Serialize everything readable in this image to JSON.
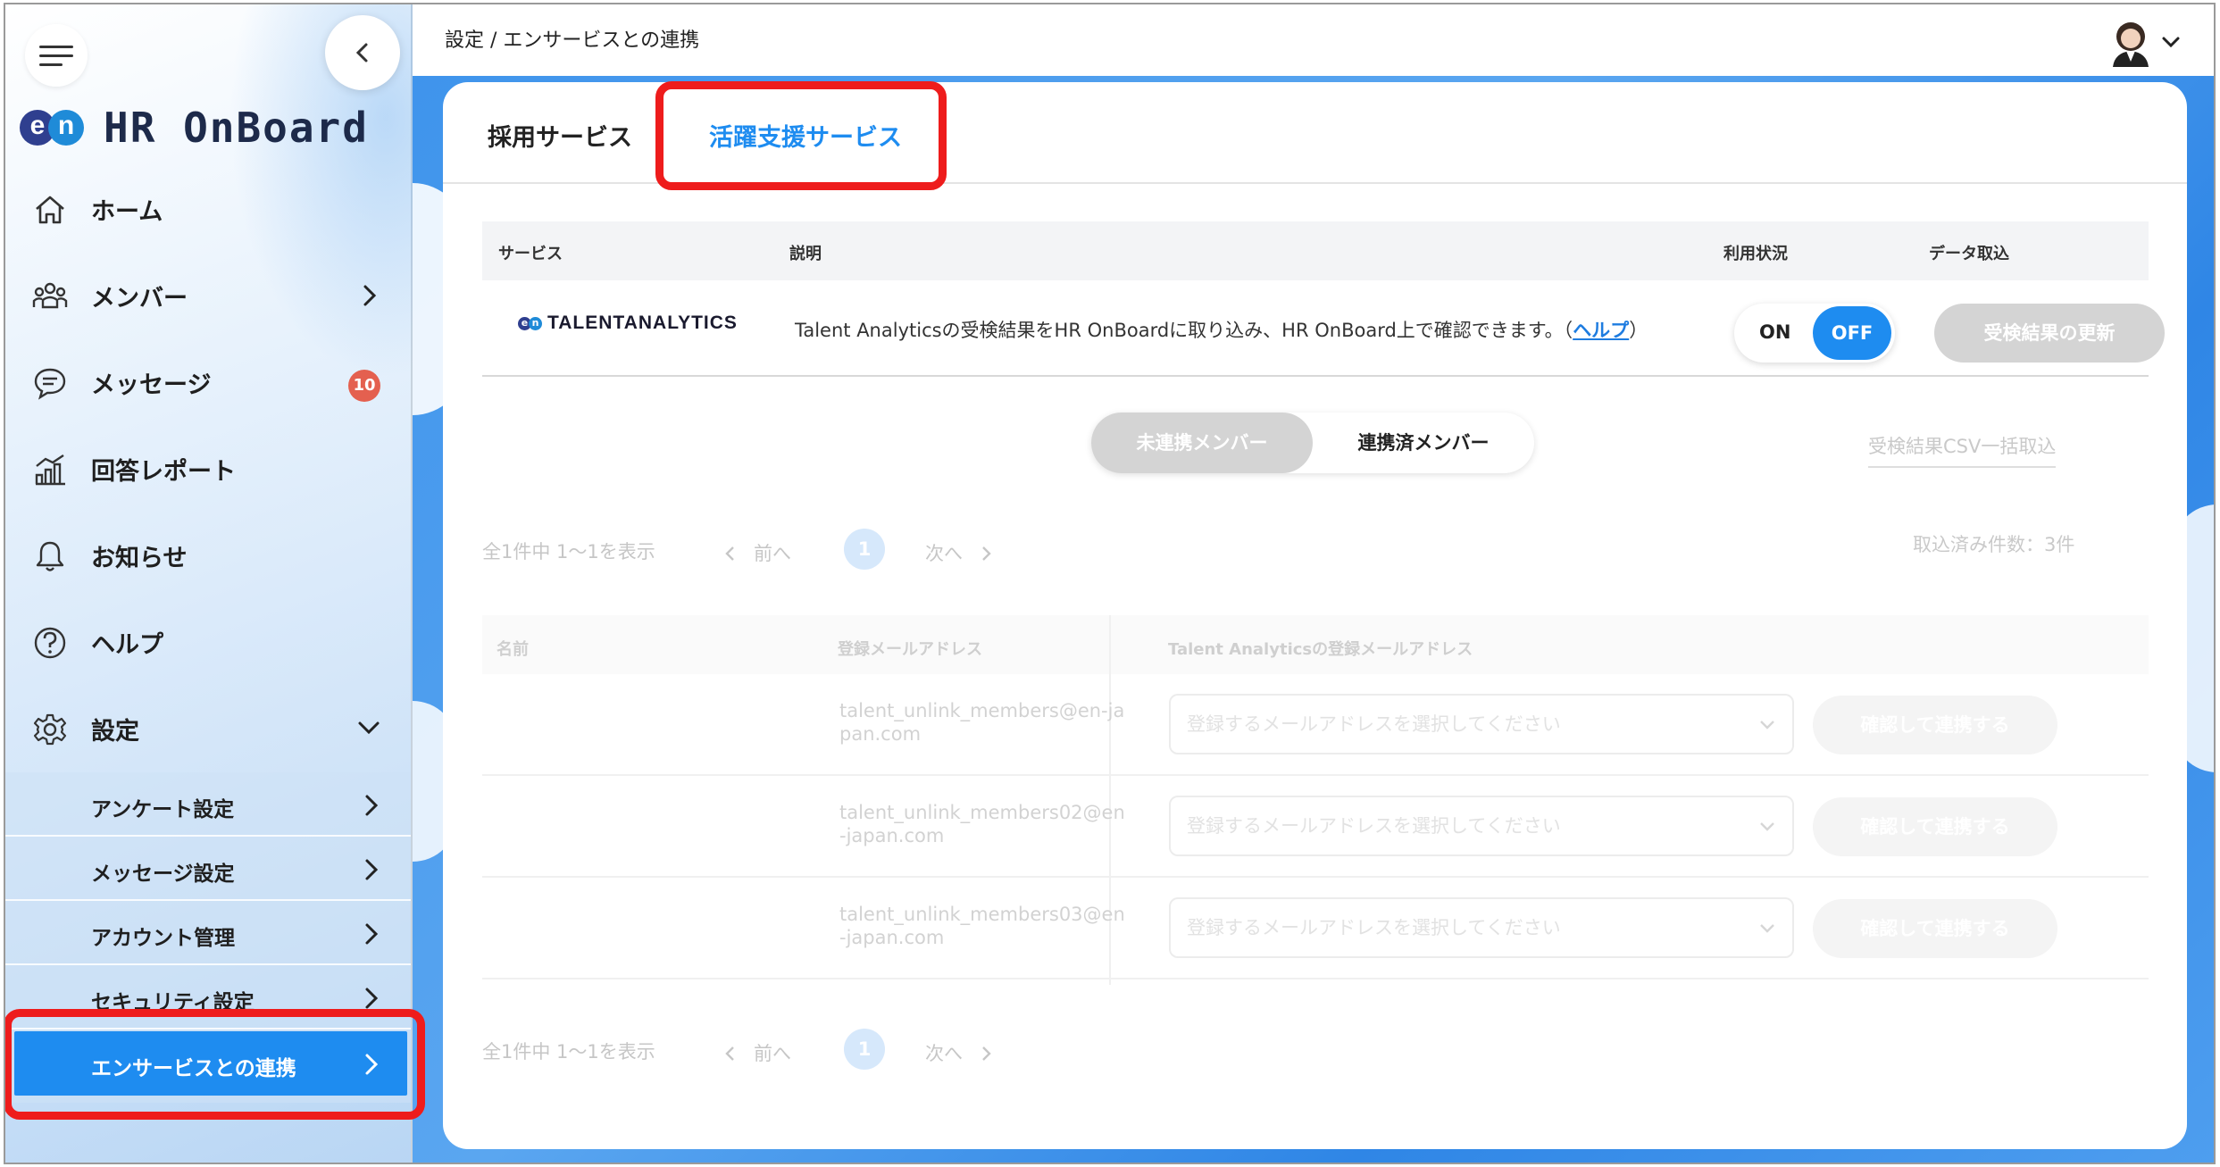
{
  "app": {
    "logo_mark": [
      "e",
      "n"
    ],
    "logo_text": "HR OnBoard",
    "accent_color": "#1e8cf0"
  },
  "sidebar": {
    "items": [
      {
        "label": "ホーム",
        "icon": "home-icon"
      },
      {
        "label": "メンバー",
        "icon": "members-icon"
      },
      {
        "label": "メッセージ",
        "icon": "message-icon",
        "badge": "10"
      },
      {
        "label": "回答レポート",
        "icon": "report-icon"
      },
      {
        "label": "お知らせ",
        "icon": "bell-icon"
      },
      {
        "label": "ヘルプ",
        "icon": "help-icon"
      },
      {
        "label": "設定",
        "icon": "gear-icon"
      }
    ],
    "settings_sub": [
      {
        "label": "アンケート設定"
      },
      {
        "label": "メッセージ設定"
      },
      {
        "label": "アカウント管理"
      },
      {
        "label": "セキュリティ設定"
      },
      {
        "label": "エンサービスとの連携",
        "active": true
      }
    ]
  },
  "header": {
    "breadcrumb": "設定 / エンサービスとの連携"
  },
  "tabs": [
    {
      "label": "採用サービス",
      "active": false
    },
    {
      "label": "活躍支援サービス",
      "active": true
    }
  ],
  "service_table": {
    "headers": [
      "サービス",
      "説明",
      "利用状況",
      "データ取込"
    ],
    "row": {
      "service_logo_mark": [
        "e",
        "n"
      ],
      "service_name": "TALENTANALYTICS",
      "description": "Talent Analyticsの受検結果をHR OnBoardに取り込み、HR OnBoard上で確認できます。（",
      "help_link": "ヘルプ",
      "description_end": "）",
      "toggle_on": "ON",
      "toggle_off": "OFF",
      "toggle_state": "OFF",
      "update_button": "受検結果の更新"
    }
  },
  "member_filter": {
    "unlinked": "未連携メンバー",
    "linked": "連携済メンバー",
    "selected": "未連携メンバー",
    "csv_import": "受検結果CSV一括取込"
  },
  "pagination": {
    "count_text": "全1件中 1〜1を表示",
    "prev": "前へ",
    "page": "1",
    "next": "次へ"
  },
  "imported_count": "取込済み件数：3件",
  "members_table": {
    "headers": [
      "名前",
      "登録メールアドレス",
      "Talent Analyticsの登録メールアドレス"
    ],
    "rows": [
      {
        "name": "",
        "email": "talent_unlink_members@en-japan.com",
        "select_placeholder": "登録するメールアドレスを選択してください",
        "button": "確認して連携する"
      },
      {
        "name": "",
        "email": "talent_unlink_members02@en-japan.com",
        "select_placeholder": "登録するメールアドレスを選択してください",
        "button": "確認して連携する"
      },
      {
        "name": "",
        "email": "talent_unlink_members03@en-japan.com",
        "select_placeholder": "登録するメールアドレスを選択してください",
        "button": "確認して連携する"
      }
    ]
  }
}
